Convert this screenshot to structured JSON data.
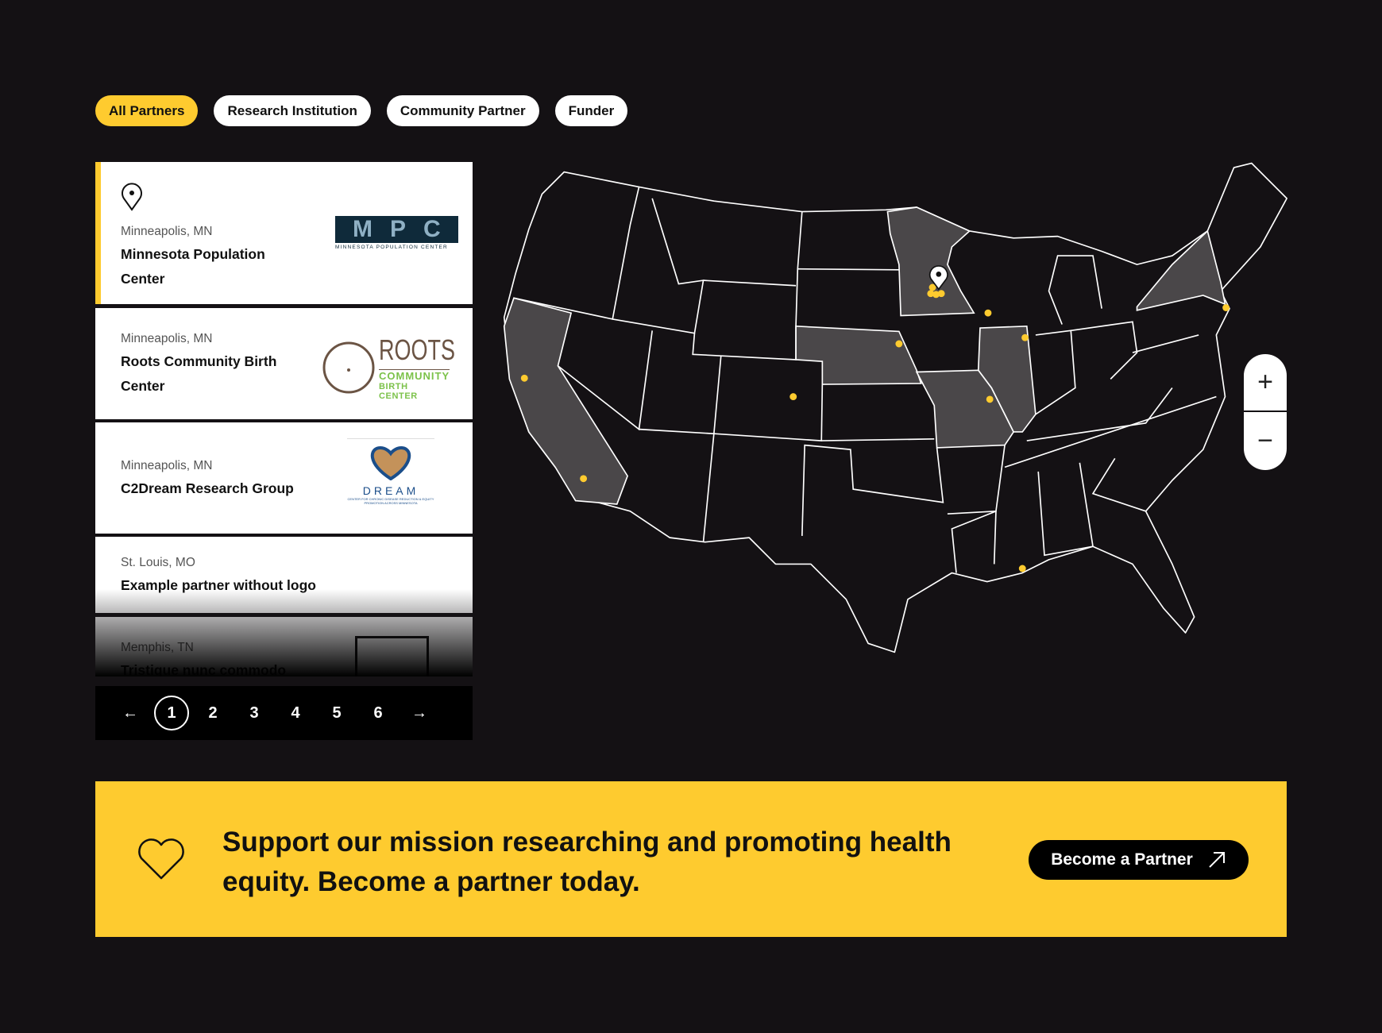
{
  "filters": [
    {
      "label": "All Partners",
      "active": true
    },
    {
      "label": "Research Institution",
      "active": false
    },
    {
      "label": "Community Partner",
      "active": false
    },
    {
      "label": "Funder",
      "active": false
    }
  ],
  "partners": [
    {
      "location": "Minneapolis, MN",
      "name": "Minnesota Population Center",
      "logo": {
        "text": "MPC",
        "subtitle": "MINNESOTA POPULATION CENTER"
      }
    },
    {
      "location": "Minneapolis, MN",
      "name": "Roots Community Birth Center",
      "logo": {
        "text": "ROOTS",
        "line2": "COMMUNITY",
        "line3": "BIRTH CENTER"
      }
    },
    {
      "location": "Minneapolis, MN",
      "name": "C2Dream Research Group",
      "logo": {
        "text": "DREAM",
        "subtitle": "CENTER FOR CHRONIC DISEASE REDUCTION & EQUITY PROMOTION ACROSS MINNESOTA"
      }
    },
    {
      "location": "St. Louis, MO",
      "name": "Example partner without logo"
    },
    {
      "location": "Memphis, TN",
      "name": "Tristique nunc commodo"
    }
  ],
  "pagination": {
    "current": "1",
    "pages": [
      "2",
      "3",
      "4",
      "5",
      "6"
    ]
  },
  "map": {
    "highlighted_states": [
      "MN",
      "NE",
      "MO",
      "IL",
      "CA",
      "NY"
    ],
    "marker_color": "#fecb2f",
    "highlight_color": "#4a4749"
  },
  "zoom": {
    "in": "+",
    "out": "−"
  },
  "banner": {
    "text": "Support our mission researching and promoting health equity. Become a partner today.",
    "button": "Become a Partner"
  },
  "colors": {
    "accent": "#fecb2f",
    "background": "#141114"
  }
}
